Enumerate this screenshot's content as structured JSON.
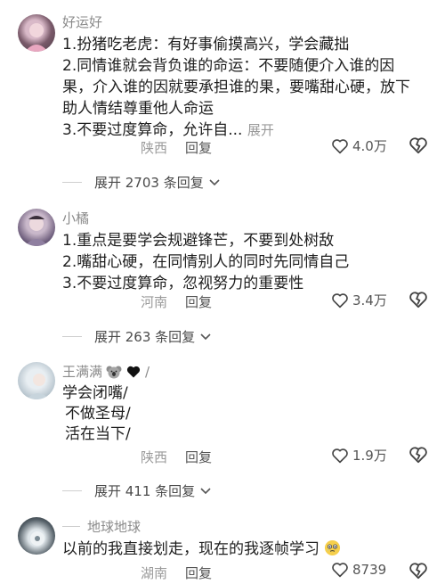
{
  "comments": [
    {
      "username": "好运好",
      "lines": [
        "1.扮猪吃老虎：有好事偷摸高兴，学会藏拙",
        "2.同情谁就会背负谁的命运：不要随便介入谁的因",
        "果，介入谁的因就要承担谁的果，要嘴甜心硬，放下",
        "助人情结尊重他人命运",
        "3.不要过度算命，允许自..."
      ],
      "inline_expand": "展开",
      "location": "陕西",
      "reply_label": "回复",
      "likes": "4.0万",
      "expand_replies": "展开 2703 条回复"
    },
    {
      "username": "小橘",
      "lines": [
        "1.重点是要学会规避锋芒，不要到处树敌",
        "2.嘴甜心硬，在同情别人的同时先同情自己",
        "3.不要过度算命，忽视努力的重要性"
      ],
      "location": "河南",
      "reply_label": "回复",
      "likes": "3.4万",
      "expand_replies": "展开 263 条回复"
    },
    {
      "username": "王满满",
      "username_suffix": "/",
      "lines": [
        "学会闭嘴/",
        "不做圣母/",
        "活在当下/"
      ],
      "location": "陕西",
      "reply_label": "回复",
      "likes": "1.9万",
      "expand_replies": "展开 411 条回复"
    },
    {
      "username": "地球地球",
      "lines": [
        "以前的我直接划走，现在的我逐帧学习"
      ],
      "location": "湖南",
      "reply_label": "回复",
      "likes": "8739"
    }
  ],
  "icons": {
    "like": "heart-outline-icon",
    "dislike": "broken-heart-icon",
    "expand": "chevron-down-icon",
    "emoji_koala": "koala-emoji-icon",
    "emoji_heart": "black-heart-emoji-icon",
    "emoji_tear": "teary-face-emoji-icon"
  },
  "colors": {
    "text": "#1e1e1e",
    "muted": "#9a9a9a",
    "background": "#ffffff"
  }
}
